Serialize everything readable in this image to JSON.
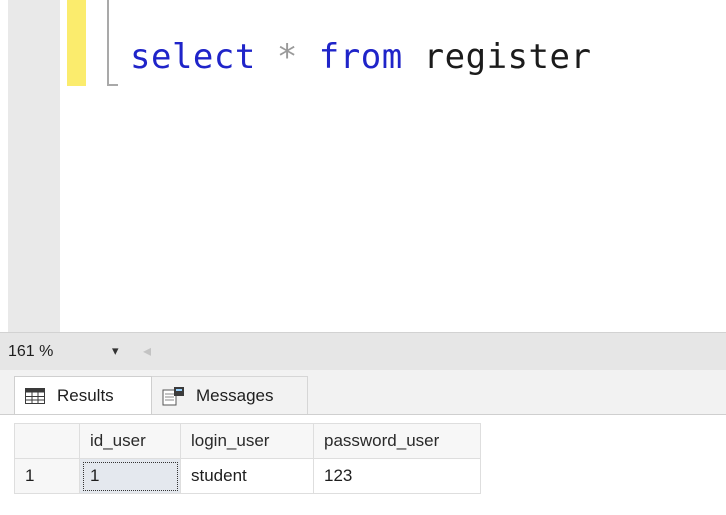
{
  "editor": {
    "query": {
      "keyword1": "select",
      "operator": "*",
      "keyword2": "from",
      "table": "register"
    }
  },
  "statusbar": {
    "zoom": "161 %",
    "zoom_caret": "▾",
    "scroll_left": "◂"
  },
  "tabs": [
    {
      "label": "Results",
      "icon": "grid-icon"
    },
    {
      "label": "Messages",
      "icon": "messages-icon"
    }
  ],
  "grid": {
    "columns": [
      "id_user",
      "login_user",
      "password_user"
    ],
    "rows": [
      {
        "rownum": "1",
        "cells": [
          "1",
          "student",
          "123"
        ]
      }
    ]
  },
  "colors": {
    "keyword": "#1f24c9",
    "change_bar": "#fbec6d",
    "selected_cell": "#e4e8ee"
  }
}
